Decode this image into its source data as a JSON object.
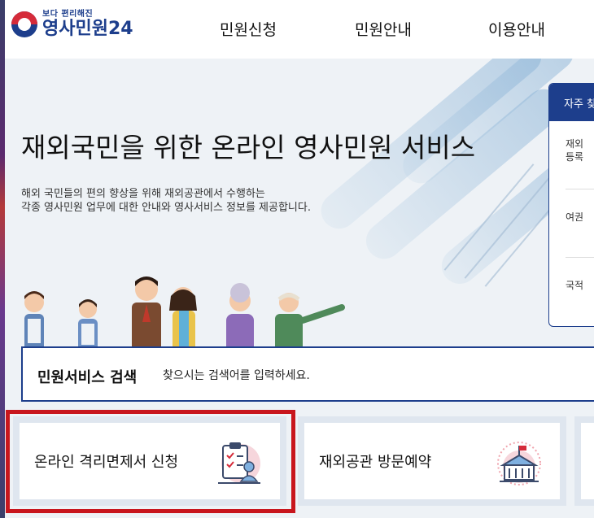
{
  "header": {
    "logo_sub": "보다 편리해진",
    "logo_main": "영사민원24",
    "nav": [
      "민원신청",
      "민원안내",
      "이용안내"
    ]
  },
  "hero": {
    "title": "재외국민을 위한 온라인 영사민원 서비스",
    "desc_line1": "해외 국민들의 편의 향상을 위해 재외공관에서 수행하는",
    "desc_line2": "각종 영사민원 업무에 대한 안내와 영사서비스 정보를 제공합니다."
  },
  "faq": {
    "title": "자주 찾",
    "items": [
      "재외\n등록",
      "여권",
      "국적"
    ]
  },
  "search": {
    "label": "민원서비스 검색",
    "placeholder": "찾으시는 검색어를 입력하세요."
  },
  "cards": [
    {
      "label": "온라인 격리면제서 신청",
      "icon": "document-checklist-icon"
    },
    {
      "label": "재외공관 방문예약",
      "icon": "embassy-building-icon"
    }
  ],
  "colors": {
    "brand_blue": "#1d3e8c",
    "brand_red": "#d52b3a",
    "highlight": "#c8161d"
  }
}
